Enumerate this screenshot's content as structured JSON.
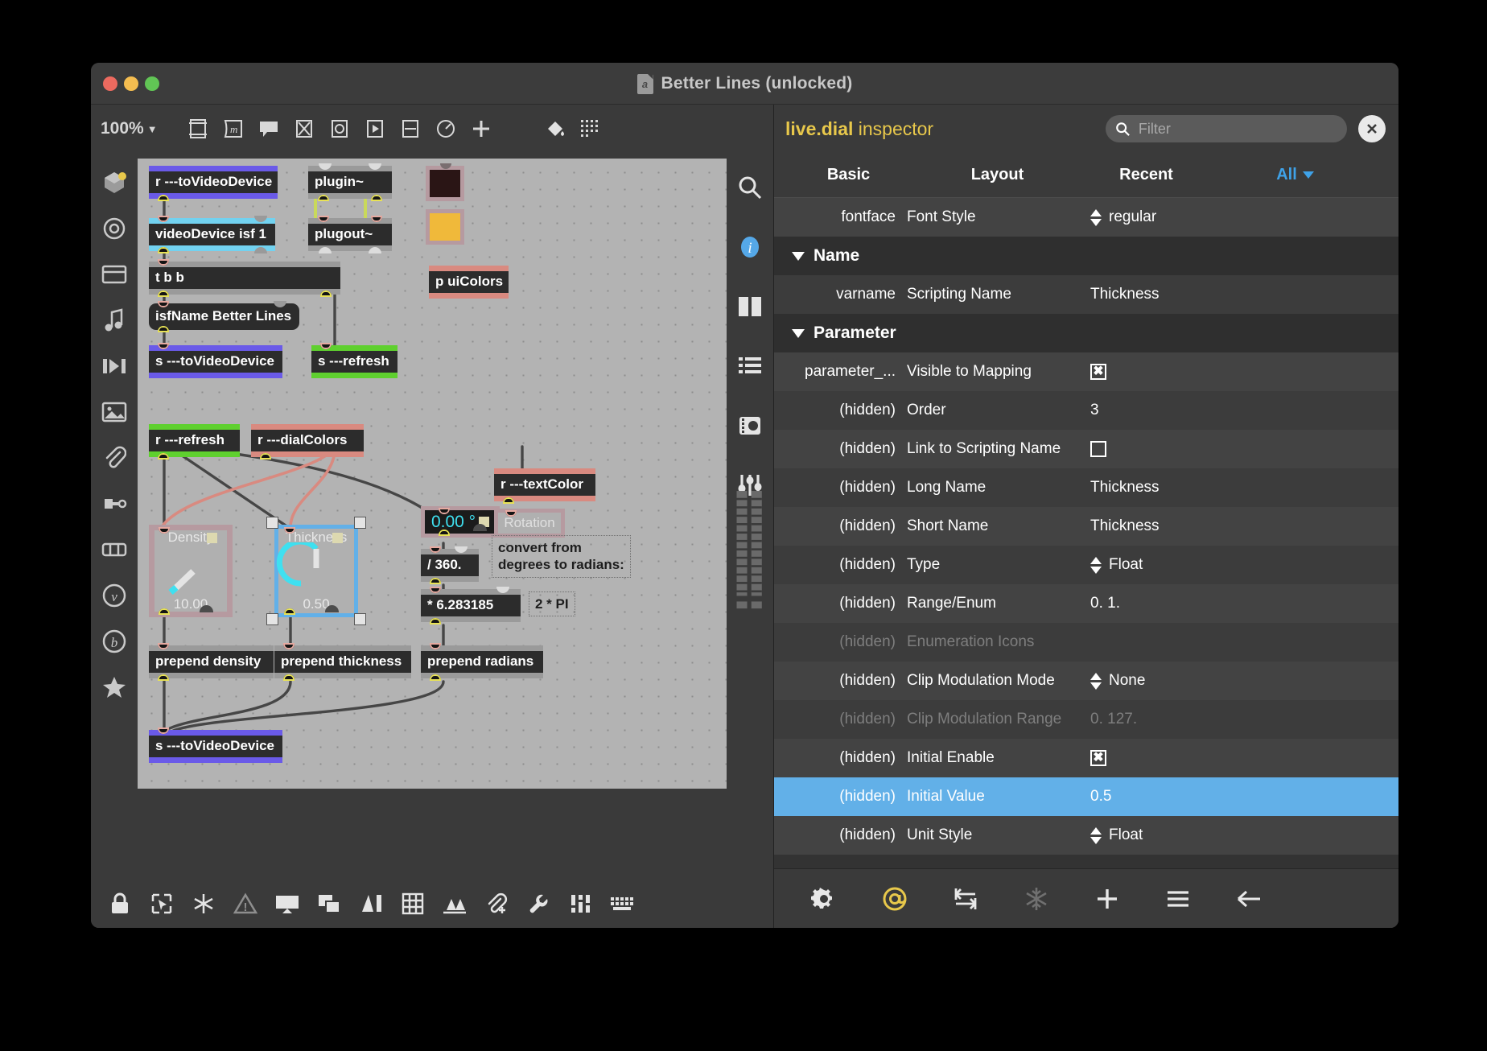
{
  "window": {
    "title": "Better Lines (unlocked)",
    "doc_icon": "max-patcher-icon",
    "traffic": {
      "close": "close-button",
      "minimize": "minimize-button",
      "zoom": "zoom-button"
    }
  },
  "patcher": {
    "zoom_level": "100%",
    "toolbar_icons": [
      "new-object-icon",
      "message-box-icon",
      "comment-icon",
      "toggle-icon",
      "button-icon",
      "play-icon",
      "slider-icon",
      "dial-icon",
      "add-icon"
    ],
    "palette_icons": [
      "objects-icon",
      "circle-icon",
      "panel-icon",
      "music-icon",
      "jitter-icon",
      "image-icon",
      "attach-icon",
      "plug-icon",
      "controls-icon",
      "vizzie-icon",
      "beap-icon",
      "favorites-icon"
    ],
    "right_icons": [
      "search-icon",
      "info-icon",
      "sidebar-icon",
      "list-icon",
      "snapshot-icon",
      "sliders-icon",
      "meters-icon"
    ],
    "bottom_icons": [
      "lock-icon",
      "edit-icon",
      "freeze-icon",
      "warning-icon",
      "presentation-icon",
      "duplicate-icon",
      "arrange-icon",
      "grid-icon",
      "distribute-icon",
      "attach-file-icon",
      "wrench-icon",
      "mixer-icon",
      "keyboard-icon"
    ],
    "objects": {
      "r_to_video_device": "r ---toVideoDevice",
      "video_device": "videoDevice isf 1",
      "trigger": "t b b",
      "isf_name": "isfName Better Lines",
      "s_to_video_device": "s ---toVideoDevice",
      "plugin": "plugin~",
      "plugout": "plugout~",
      "p_ui_colors": "p uiColors",
      "s_refresh": "s ---refresh",
      "r_refresh": "r ---refresh",
      "r_dial_colors": "r ---dialColors",
      "r_text_color": "r ---textColor",
      "rotation_label": "Rotation",
      "degrees_number": "0.00 °",
      "div_360": "/ 360.",
      "mult_two_pi": "* 6.283185",
      "two_pi_comment": "2 * PI",
      "convert_comment": "convert from\ndegrees to radians:",
      "prepend_density": "prepend density",
      "prepend_thickness": "prepend thickness",
      "prepend_radians": "prepend radians",
      "s_to_video_device_2": "s ---toVideoDevice"
    },
    "dials": [
      {
        "label": "Density",
        "value": "10.00",
        "selected": false
      },
      {
        "label": "Thickness",
        "value": "0.50",
        "selected": true
      }
    ]
  },
  "inspector": {
    "object_name": "live.dial",
    "title_suffix": "inspector",
    "filter_placeholder": "Filter",
    "filter_value": "",
    "close_label": "close-inspector",
    "tabs": [
      {
        "label": "Basic",
        "active": false
      },
      {
        "label": "Layout",
        "active": false
      },
      {
        "label": "Recent",
        "active": false
      },
      {
        "label": "All",
        "active": true
      }
    ],
    "rows": [
      {
        "kind": "row",
        "attr": "fontface",
        "name": "Font Style",
        "value": "regular",
        "control": "spinner",
        "dim": false,
        "selected": false
      },
      {
        "kind": "group",
        "attr": "",
        "name": "Name",
        "value": "",
        "control": "none",
        "dim": false,
        "selected": false
      },
      {
        "kind": "row",
        "attr": "varname",
        "name": "Scripting Name",
        "value": "Thickness",
        "control": "text",
        "dim": false,
        "selected": false
      },
      {
        "kind": "group",
        "attr": "",
        "name": "Parameter",
        "value": "",
        "control": "none",
        "dim": false,
        "selected": false
      },
      {
        "kind": "row",
        "attr": "parameter_...",
        "name": "Visible to Mapping",
        "value": "",
        "control": "checked",
        "dim": false,
        "selected": false
      },
      {
        "kind": "row",
        "attr": "(hidden)",
        "name": "Order",
        "value": "3",
        "control": "text",
        "dim": false,
        "selected": false
      },
      {
        "kind": "row",
        "attr": "(hidden)",
        "name": "Link to Scripting Name",
        "value": "",
        "control": "unchecked",
        "dim": false,
        "selected": false
      },
      {
        "kind": "row",
        "attr": "(hidden)",
        "name": "Long Name",
        "value": "Thickness",
        "control": "text",
        "dim": false,
        "selected": false
      },
      {
        "kind": "row",
        "attr": "(hidden)",
        "name": "Short Name",
        "value": "Thickness",
        "control": "text",
        "dim": false,
        "selected": false
      },
      {
        "kind": "row",
        "attr": "(hidden)",
        "name": "Type",
        "value": "Float",
        "control": "spinner",
        "dim": false,
        "selected": false
      },
      {
        "kind": "row",
        "attr": "(hidden)",
        "name": "Range/Enum",
        "value": "0. 1.",
        "control": "text",
        "dim": false,
        "selected": false
      },
      {
        "kind": "row",
        "attr": "(hidden)",
        "name": "Enumeration Icons",
        "value": "",
        "control": "text",
        "dim": true,
        "selected": false
      },
      {
        "kind": "row",
        "attr": "(hidden)",
        "name": "Clip Modulation Mode",
        "value": "None",
        "control": "spinner",
        "dim": false,
        "selected": false
      },
      {
        "kind": "row",
        "attr": "(hidden)",
        "name": "Clip Modulation Range",
        "value": "0. 127.",
        "control": "text",
        "dim": true,
        "selected": false
      },
      {
        "kind": "row",
        "attr": "(hidden)",
        "name": "Initial Enable",
        "value": "",
        "control": "checked",
        "dim": false,
        "selected": false
      },
      {
        "kind": "row",
        "attr": "(hidden)",
        "name": "Initial Value",
        "value": "0.5",
        "control": "text",
        "dim": false,
        "selected": true
      },
      {
        "kind": "row",
        "attr": "(hidden)",
        "name": "Unit Style",
        "value": "Float",
        "control": "spinner",
        "dim": false,
        "selected": false
      }
    ],
    "bottom_icons": [
      "gear-icon",
      "at-sign-icon",
      "swap-icon",
      "snowflake-icon",
      "plus-icon",
      "menu-icon",
      "back-arrow-icon"
    ]
  },
  "colors": {
    "accent_yellow": "#e8c84b",
    "accent_blue": "#62b0e8",
    "select_blue": "#3fa2e8",
    "send_blue": "#6a5ae8",
    "refresh_green": "#5fd02f",
    "dial_red": "#d98a80",
    "cyan": "#3fe0f0"
  }
}
